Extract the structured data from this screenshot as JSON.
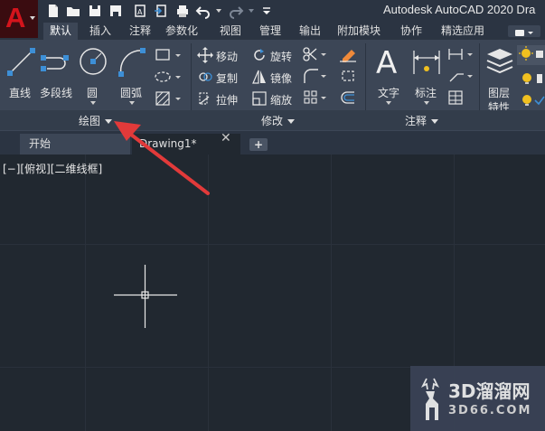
{
  "app": {
    "logo_letter": "A",
    "window_title": "Autodesk AutoCAD 2020  Dra"
  },
  "ribbon_tabs": [
    {
      "label": "默认",
      "active": true
    },
    {
      "label": "插入"
    },
    {
      "label": "注释"
    },
    {
      "label": "参数化"
    },
    {
      "label": "视图"
    },
    {
      "label": "管理"
    },
    {
      "label": "输出"
    },
    {
      "label": "附加模块"
    },
    {
      "label": "协作"
    },
    {
      "label": "精选应用"
    }
  ],
  "panels": {
    "draw": {
      "label": "绘图",
      "tools": {
        "line": "直线",
        "polyline": "多段线",
        "circle": "圆",
        "arc": "圆弧"
      }
    },
    "modify": {
      "label": "修改",
      "tools": {
        "move": "移动",
        "rotate": "旋转",
        "copy": "复制",
        "mirror": "镜像",
        "stretch": "拉伸",
        "scale": "缩放"
      }
    },
    "annotation": {
      "label": "注释",
      "tools": {
        "text": "文字",
        "dimension": "标注"
      }
    },
    "layers": {
      "tools": {
        "layer_properties_line1": "图层",
        "layer_properties_line2": "特性"
      }
    }
  },
  "file_tabs": {
    "start": "开始",
    "drawing": "Drawing1*",
    "close_glyph": "✕",
    "new_glyph": "+"
  },
  "viewport": {
    "label": "[−][俯视][二维线框]"
  },
  "watermark": {
    "text": "3D溜溜网",
    "sub": "3D66.COM"
  },
  "colors": {
    "accent_red": "#d4141c",
    "annotation_arrow": "#e23a3a",
    "ribbon_bg": "#3c4656",
    "canvas_bg": "#212830",
    "icon_blue": "#3d8fd6"
  }
}
